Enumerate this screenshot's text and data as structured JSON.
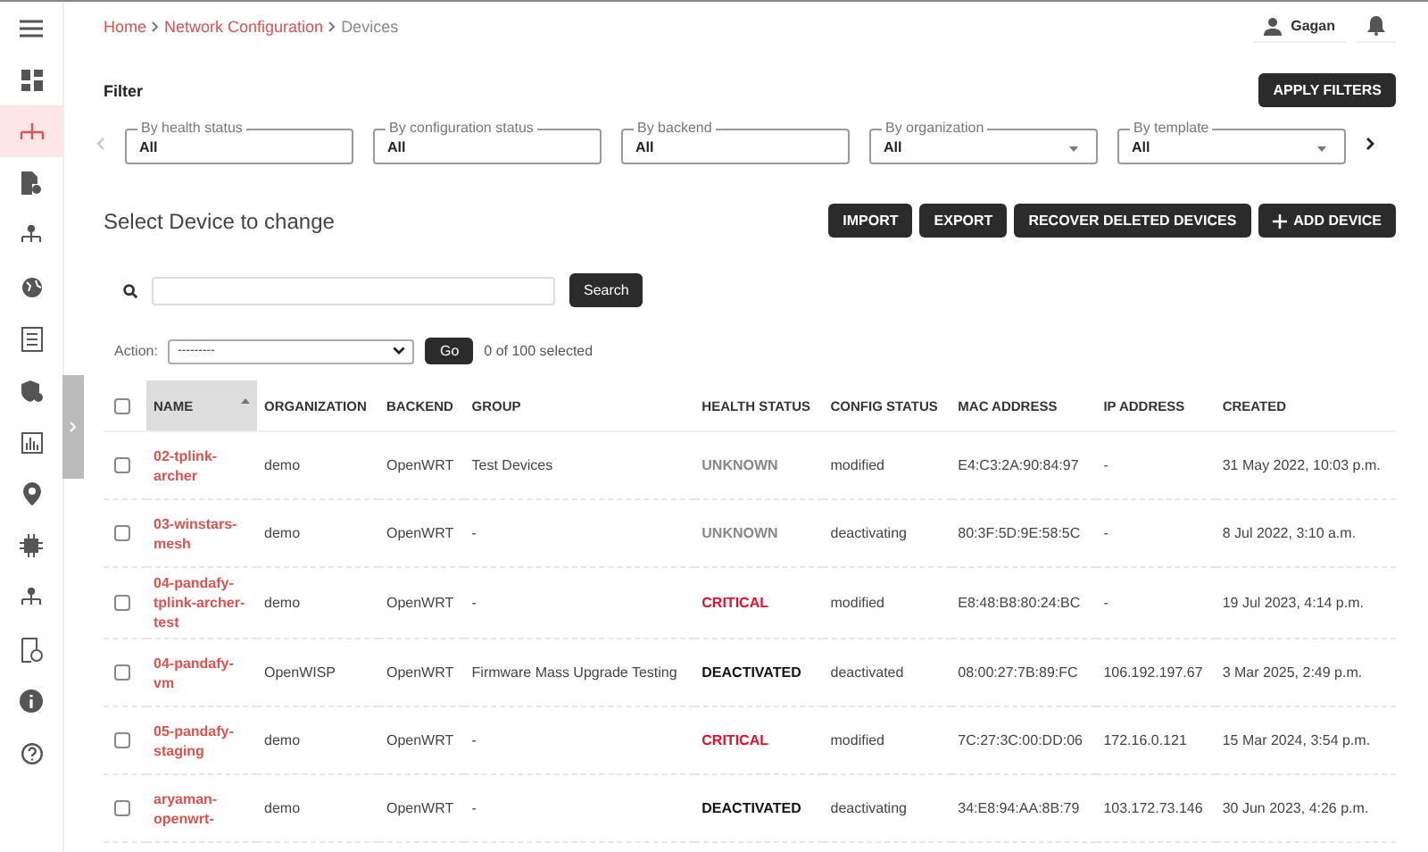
{
  "breadcrumbs": [
    {
      "label": "Home",
      "link": true
    },
    {
      "label": "Network Configuration",
      "link": true
    },
    {
      "label": "Devices",
      "link": false
    }
  ],
  "user": {
    "name": "Gagan"
  },
  "sidebar": {
    "items": [
      {
        "selected": false
      },
      {
        "selected": true
      },
      {
        "selected": false
      },
      {
        "selected": false
      },
      {
        "selected": false
      },
      {
        "selected": false
      },
      {
        "selected": false
      },
      {
        "selected": false
      },
      {
        "selected": false
      },
      {
        "selected": false
      },
      {
        "selected": false
      },
      {
        "selected": false
      },
      {
        "selected": false
      },
      {
        "selected": false
      }
    ]
  },
  "filter": {
    "title": "Filter",
    "apply_button": "APPLY FILTERS",
    "fields": [
      {
        "label": "By health status",
        "value": "All",
        "kind": "text"
      },
      {
        "label": "By configuration status",
        "value": "All",
        "kind": "text"
      },
      {
        "label": "By backend",
        "value": "All",
        "kind": "text"
      },
      {
        "label": "By organization",
        "value": "All",
        "kind": "select"
      },
      {
        "label": "By template",
        "value": "All",
        "kind": "select"
      }
    ]
  },
  "heading": "Select Device to change",
  "actions": [
    "IMPORT",
    "EXPORT",
    "RECOVER DELETED DEVICES",
    "ADD DEVICE"
  ],
  "search": {
    "button": "Search"
  },
  "action_bar": {
    "label": "Action:",
    "value": "---------",
    "go": "Go",
    "count": "0 of 100 selected"
  },
  "table": {
    "select_all_checked": false,
    "columns": [
      "NAME",
      "ORGANIZATION",
      "BACKEND",
      "GROUP",
      "HEALTH STATUS",
      "CONFIG STATUS",
      "MAC ADDRESS",
      "IP ADDRESS",
      "CREATED"
    ],
    "rows": [
      {
        "checked": false,
        "name": "02-tplink-archer",
        "organization": "demo",
        "backend": "OpenWRT",
        "group": "Test Devices",
        "health": {
          "label": "UNKNOWN",
          "color": "#888888"
        },
        "config": "modified",
        "mac": "E4:C3:2A:90:84:97",
        "ip": "-",
        "created": "31 May 2022, 10:03 p.m."
      },
      {
        "checked": false,
        "name": "03-winstars-mesh",
        "organization": "demo",
        "backend": "OpenWRT",
        "group": "-",
        "health": {
          "label": "UNKNOWN",
          "color": "#888888"
        },
        "config": "deactivating",
        "mac": "80:3F:5D:9E:58:5C",
        "ip": "-",
        "created": "8 Jul 2022, 3:10 a.m."
      },
      {
        "checked": false,
        "name": "04-pandafy-tplink-archer-test",
        "organization": "demo",
        "backend": "OpenWRT",
        "group": "-",
        "health": {
          "label": "CRITICAL",
          "color": "#e0102e"
        },
        "config": "modified",
        "mac": "E8:48:B8:80:24:BC",
        "ip": "-",
        "created": "19 Jul 2023, 4:14 p.m."
      },
      {
        "checked": false,
        "name": "04-pandafy-vm",
        "organization": "OpenWISP",
        "backend": "OpenWRT",
        "group": "Firmware Mass Upgrade Testing",
        "health": {
          "label": "DEACTIVATED",
          "color": "#111111"
        },
        "config": "deactivated",
        "mac": "08:00:27:7B:89:FC",
        "ip": "106.192.197.67",
        "created": "3 Mar 2025, 2:49 p.m."
      },
      {
        "checked": false,
        "name": "05-pandafy-staging",
        "organization": "demo",
        "backend": "OpenWRT",
        "group": "-",
        "health": {
          "label": "CRITICAL",
          "color": "#e0102e"
        },
        "config": "modified",
        "mac": "7C:27:3C:00:DD:06",
        "ip": "172.16.0.121",
        "created": "15 Mar 2024, 3:54 p.m."
      },
      {
        "checked": false,
        "name": "aryaman-openwrt-",
        "organization": "demo",
        "backend": "OpenWRT",
        "group": "-",
        "health": {
          "label": "DEACTIVATED",
          "color": "#111111"
        },
        "config": "deactivating",
        "mac": "34:E8:94:AA:8B:79",
        "ip": "103.172.73.146",
        "created": "30 Jun 2023, 4:26 p.m."
      }
    ]
  }
}
